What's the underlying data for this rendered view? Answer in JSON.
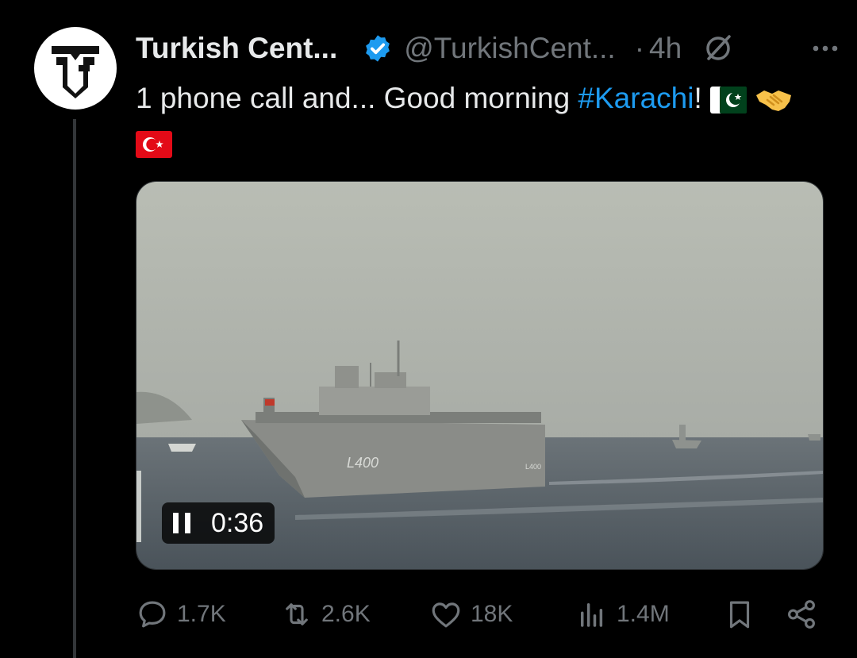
{
  "tweet": {
    "author_name": "Turkish Cent...",
    "handle": "@TurkishCent...",
    "time_separator": "·",
    "time": "4h",
    "text_before": "1 phone call and... Good morning ",
    "hashtag": "#Karachi",
    "text_after": "!"
  },
  "media": {
    "duration": "0:36",
    "ship_hull_number": "L400",
    "ship_side_number": "L400"
  },
  "actions": {
    "replies": "1.7K",
    "reposts": "2.6K",
    "likes": "18K",
    "views": "1.4M"
  },
  "icons": {
    "avatar": "tc-logo",
    "verified": "verified-badge-icon",
    "grok": "grok-icon",
    "more": "more-icon",
    "reply": "reply-icon",
    "repost": "repost-icon",
    "like": "heart-icon",
    "views": "views-icon",
    "bookmark": "bookmark-icon",
    "share": "share-icon"
  },
  "colors": {
    "background": "#000000",
    "text": "#e7e9ea",
    "muted": "#71767b",
    "accent": "#1d9bf0"
  }
}
